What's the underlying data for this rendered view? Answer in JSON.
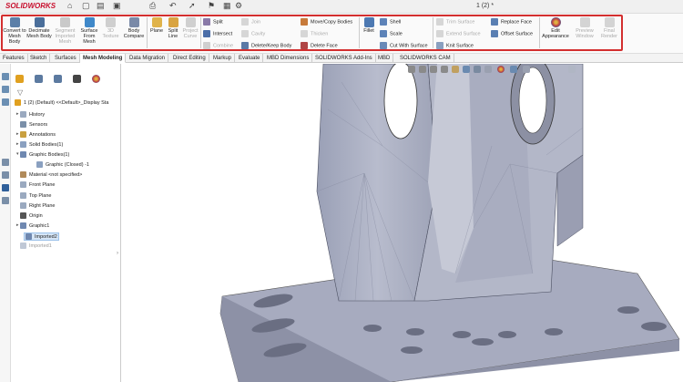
{
  "app": {
    "brand": "SOLIDWORKS",
    "document_title": "1 (2) *"
  },
  "ribbon": {
    "big_buttons": [
      {
        "label": "Convert to Mesh Body",
        "icon": "convert-mesh-icon",
        "disabled": false
      },
      {
        "label": "Decimate Mesh Body",
        "icon": "decimate-icon",
        "disabled": false
      },
      {
        "label": "Segment Imported Mesh",
        "icon": "segment-icon",
        "disabled": true
      },
      {
        "label": "Surface From Mesh",
        "icon": "surface-mesh-icon",
        "disabled": false
      },
      {
        "label": "3D Texture",
        "icon": "texture-icon",
        "disabled": true
      },
      {
        "label": "Body Compare",
        "icon": "compare-icon",
        "disabled": false
      },
      {
        "label": "Plane",
        "icon": "plane-icon",
        "disabled": false
      },
      {
        "label": "Split Line",
        "icon": "split-line-icon",
        "disabled": false
      },
      {
        "label": "Project Curve",
        "icon": "project-curve-icon",
        "disabled": true
      },
      {
        "label": "Fillet",
        "icon": "fillet-icon",
        "disabled": false
      },
      {
        "label": "Edit Appearance",
        "icon": "appearance-icon",
        "disabled": false
      },
      {
        "label": "Preview Window",
        "icon": "preview-icon",
        "disabled": true
      },
      {
        "label": "Final Render",
        "icon": "render-icon",
        "disabled": true
      }
    ],
    "small_buttons": [
      {
        "label": "Split",
        "disabled": false
      },
      {
        "label": "Intersect",
        "disabled": false
      },
      {
        "label": "Combine",
        "disabled": true
      },
      {
        "label": "Join",
        "disabled": true
      },
      {
        "label": "Cavity",
        "disabled": true
      },
      {
        "label": "Delete/Keep Body",
        "disabled": false
      },
      {
        "label": "Move/Copy Bodies",
        "disabled": false
      },
      {
        "label": "Thicken",
        "disabled": true
      },
      {
        "label": "Delete Face",
        "disabled": false
      },
      {
        "label": "Shell",
        "disabled": false
      },
      {
        "label": "Scale",
        "disabled": false
      },
      {
        "label": "Cut With Surface",
        "disabled": false
      },
      {
        "label": "Trim Surface",
        "disabled": true
      },
      {
        "label": "Extend Surface",
        "disabled": true
      },
      {
        "label": "Knit Surface",
        "disabled": false
      },
      {
        "label": "Replace Face",
        "disabled": false
      },
      {
        "label": "Offset Surface",
        "disabled": false
      }
    ]
  },
  "tabs": [
    "Features",
    "Sketch",
    "Surfaces",
    "Mesh Modeling",
    "Data Migration",
    "Direct Editing",
    "Markup",
    "Evaluate",
    "MBD Dimensions",
    "SOLIDWORKS Add-Ins",
    "MBD",
    "SOLIDWORKS CAM"
  ],
  "active_tab": "Mesh Modeling",
  "tree": {
    "root": "1 (2) (Default) <<Default>_Display Sta",
    "items": [
      "History",
      "Sensors",
      "Annotations",
      "Solid Bodies(1)",
      "Graphic Bodies(1)",
      "Graphic (Closed) -1",
      "Material <not specified>",
      "Front Plane",
      "Top Plane",
      "Right Plane",
      "Origin",
      "Graphic1",
      "Imported2",
      "Imported1"
    ]
  },
  "colors": {
    "accent": "#d32f2f",
    "selection": "#d6e6f7",
    "model": "#a9adbf"
  }
}
